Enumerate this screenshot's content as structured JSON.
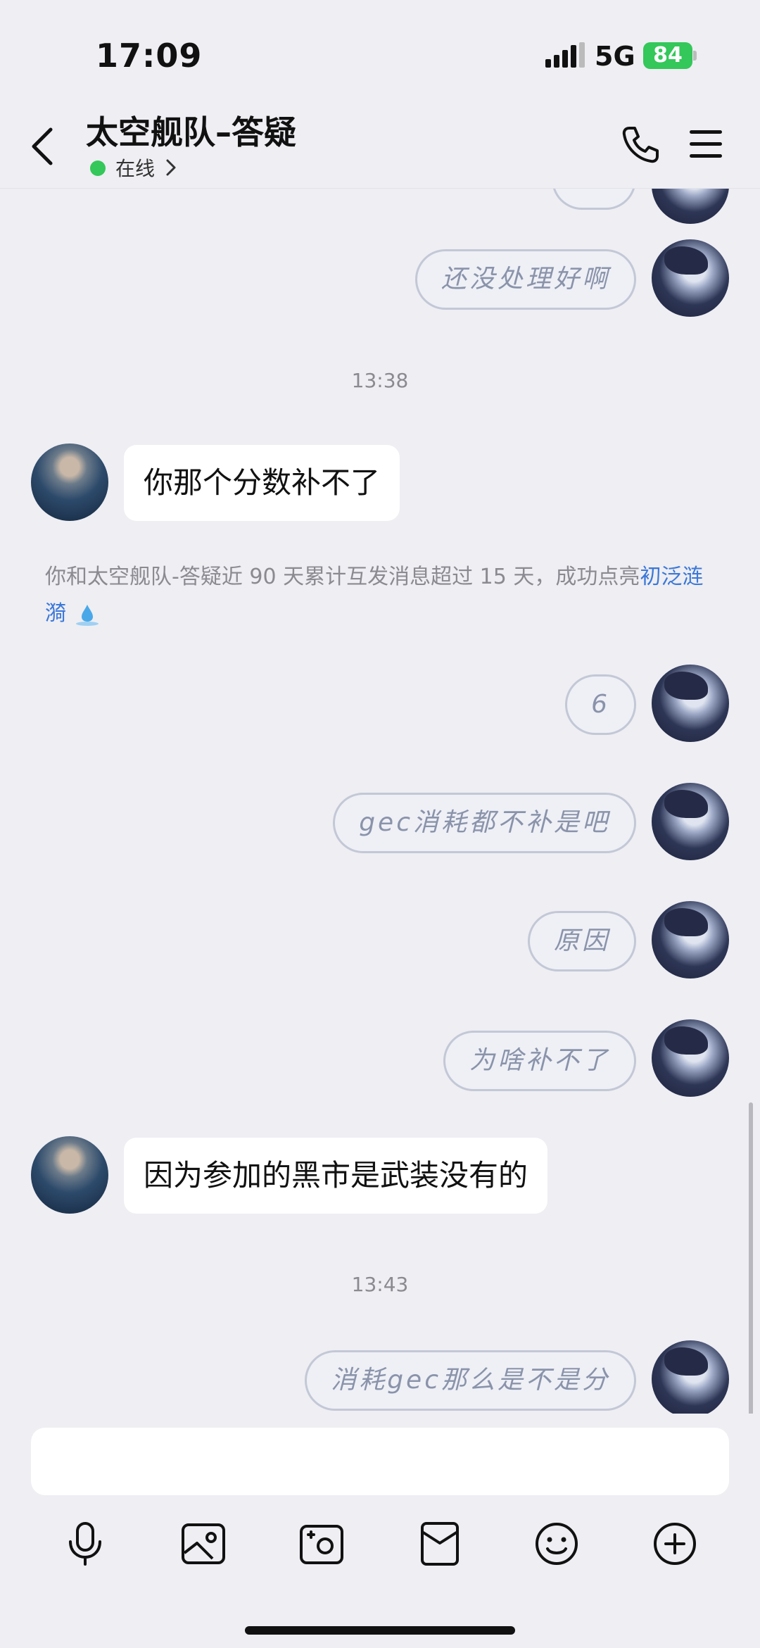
{
  "status_bar": {
    "time": "17:09",
    "network": "5G",
    "battery": "84"
  },
  "header": {
    "title": "太空舰队–答疑",
    "status": "在线"
  },
  "messages": [
    {
      "type": "me",
      "text": "还没处理好啊"
    },
    {
      "type": "time",
      "text": "13:38"
    },
    {
      "type": "them",
      "text": "你那个分数补不了"
    },
    {
      "type": "system",
      "text": "你和太空舰队-答疑近 90 天累计互发消息超过 15 天，成功点亮",
      "link": "初泛涟漪"
    },
    {
      "type": "me",
      "text": "6"
    },
    {
      "type": "me",
      "text": "gec消耗都不补是吧"
    },
    {
      "type": "me",
      "text": "原因"
    },
    {
      "type": "me",
      "text": "为啥补不了"
    },
    {
      "type": "them",
      "text": "因为参加的黑市是武装没有的"
    },
    {
      "type": "time",
      "text": "13:43"
    },
    {
      "type": "me",
      "text": "消耗gec那么是不是分"
    }
  ],
  "input": {
    "placeholder": ""
  },
  "toolbar": [
    "microphone-icon",
    "image-icon",
    "camera-icon",
    "red-packet-icon",
    "emoji-icon",
    "plus-icon"
  ]
}
